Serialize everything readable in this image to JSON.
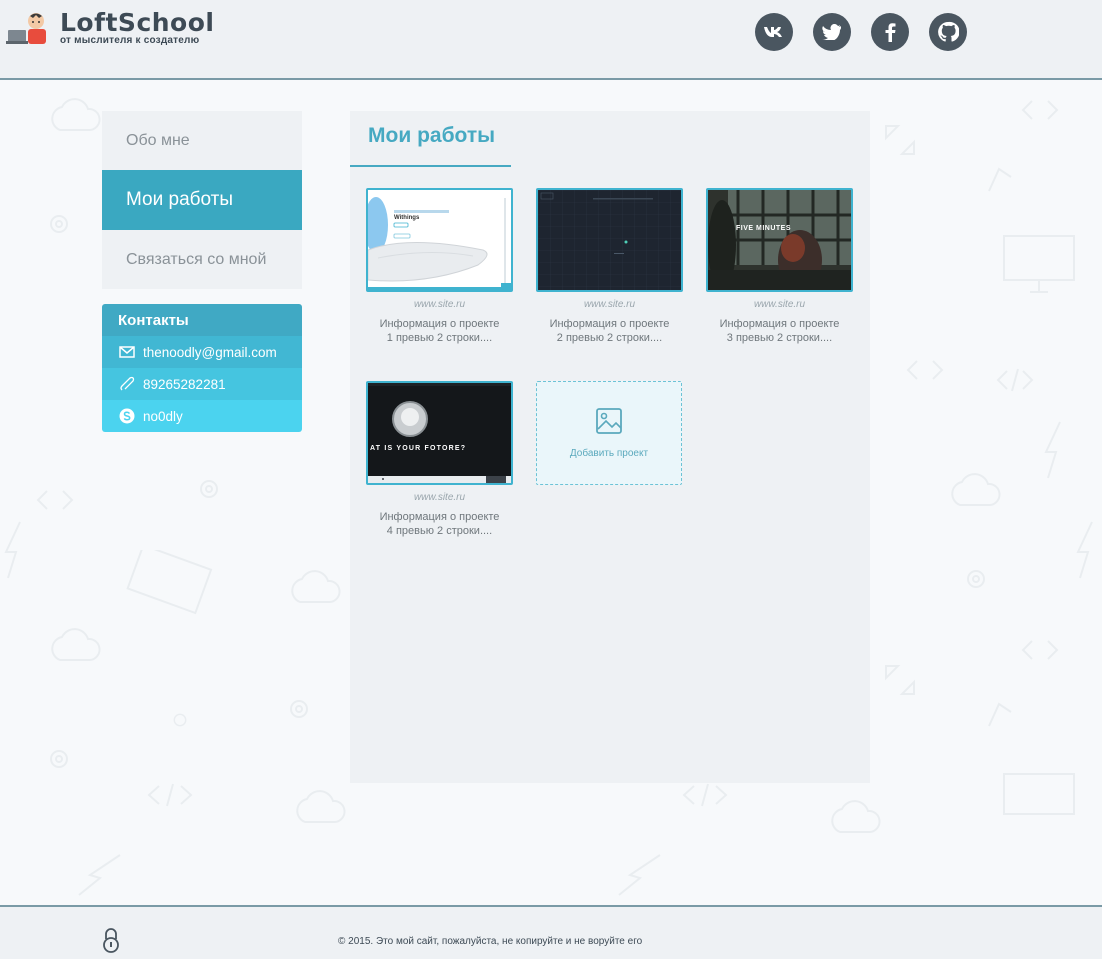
{
  "header": {
    "logo_title": "LoftSchool",
    "logo_subtitle": "от мыслителя к создателю",
    "socials": [
      {
        "name": "vk",
        "glyph": "vk"
      },
      {
        "name": "twitter",
        "glyph": "t"
      },
      {
        "name": "facebook",
        "glyph": "f"
      },
      {
        "name": "github",
        "glyph": "gh"
      }
    ]
  },
  "nav": {
    "items": [
      {
        "label": "Обо мне",
        "active": false
      },
      {
        "label": "Мои работы",
        "active": true
      },
      {
        "label": "Связаться со мной",
        "active": false
      }
    ]
  },
  "contacts": {
    "title": "Контакты",
    "email": "thenoodly@gmail.com",
    "phone": "89265282281",
    "skype": "no0dly"
  },
  "main": {
    "title": "Мои работы",
    "works": [
      {
        "url": "www.site.ru",
        "desc_line1": "Информация о проекте",
        "desc_line2": "1 превью 2 строки....",
        "thumb_brand": "Withings"
      },
      {
        "url": "www.site.ru",
        "desc_line1": "Информация о проекте",
        "desc_line2": "2 превью 2 строки...."
      },
      {
        "url": "www.site.ru",
        "desc_line1": "Информация о проекте",
        "desc_line2": "3 превью 2 строки....",
        "thumb_caption": "FIVE MINUTES"
      },
      {
        "url": "www.site.ru",
        "desc_line1": "Информация о проекте",
        "desc_line2": "4 превью 2 строки....",
        "thumb_caption": "AT IS YOUR FOTORE?"
      }
    ],
    "add_label": "Добавить проект"
  },
  "footer": {
    "copyright": "© 2015. Это мой сайт, пожалуйста, не копируйте и не воруйте его"
  },
  "colors": {
    "accent": "#3aa8c1",
    "header_bg": "#eef1f4",
    "dark_icon": "#4a5660"
  }
}
